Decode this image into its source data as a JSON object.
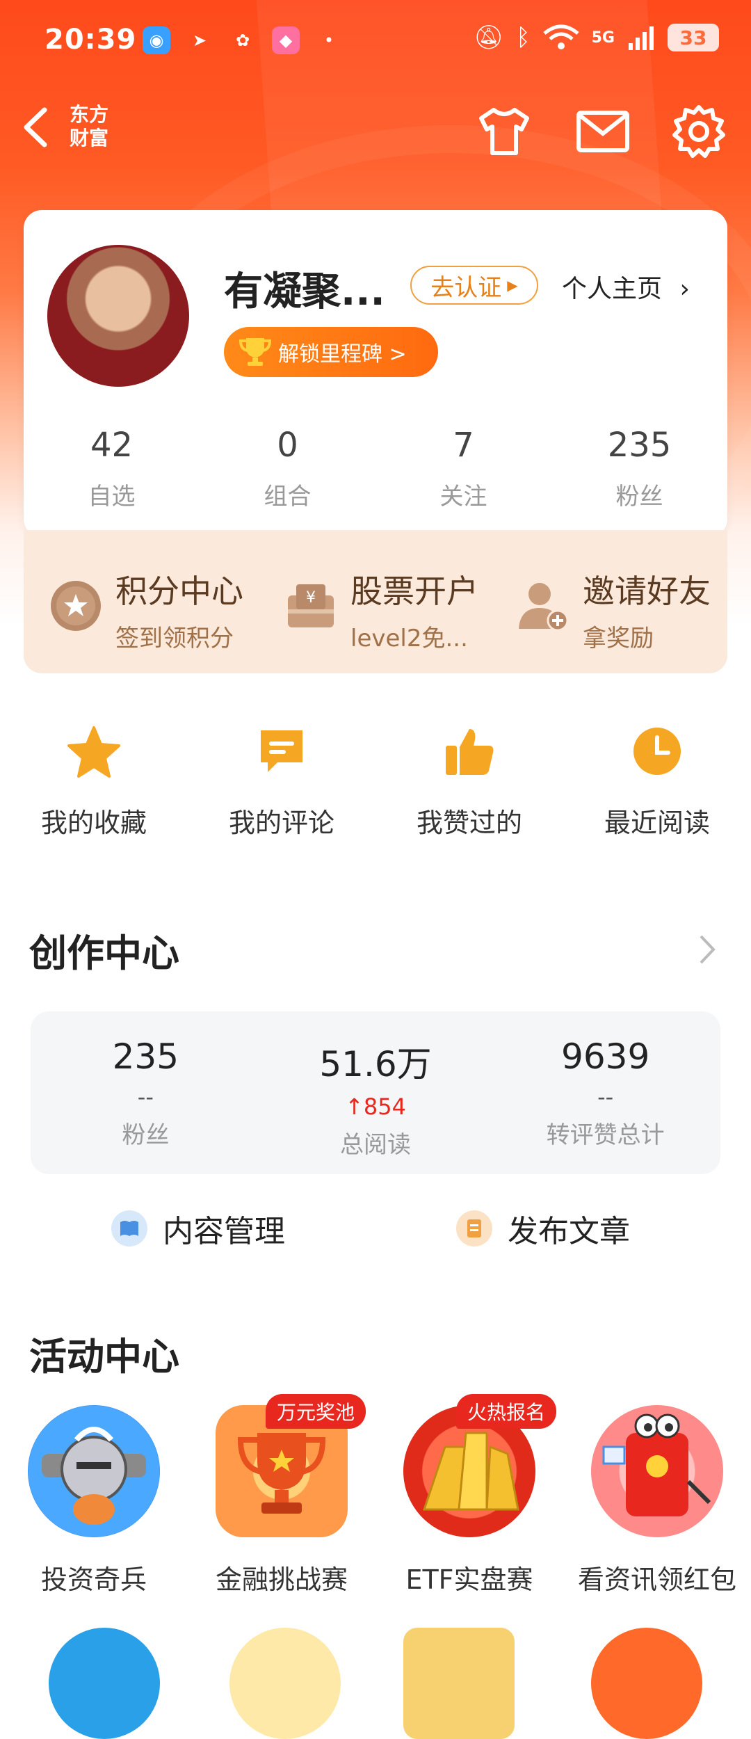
{
  "status": {
    "time": "20:39",
    "network": "5G",
    "battery": "33"
  },
  "nav": {
    "brand_line1": "东方",
    "brand_line2": "财富"
  },
  "profile": {
    "name": "有凝聚...",
    "verify_label": "去认证",
    "homepage_label": "个人主页",
    "milestone_label": "解锁里程碑 >",
    "stats": [
      {
        "value": "42",
        "label": "自选"
      },
      {
        "value": "0",
        "label": "组合"
      },
      {
        "value": "7",
        "label": "关注"
      },
      {
        "value": "235",
        "label": "粉丝"
      }
    ]
  },
  "benefits": [
    {
      "title": "积分中心",
      "sub": "签到领积分"
    },
    {
      "title": "股票开户",
      "sub": "level2免..."
    },
    {
      "title": "邀请好友",
      "sub": "拿奖励"
    }
  ],
  "quick": [
    {
      "label": "我的收藏",
      "icon": "star-icon"
    },
    {
      "label": "我的评论",
      "icon": "comment-icon"
    },
    {
      "label": "我赞过的",
      "icon": "thumbs-up-icon"
    },
    {
      "label": "最近阅读",
      "icon": "clock-icon"
    }
  ],
  "creator": {
    "title": "创作中心",
    "stats": [
      {
        "value": "235",
        "delta": "--",
        "label": "粉丝"
      },
      {
        "value": "51.6万",
        "delta": "854",
        "label": "总阅读"
      },
      {
        "value": "9639",
        "delta": "--",
        "label": "转评赞总计"
      }
    ],
    "actions": [
      {
        "label": "内容管理"
      },
      {
        "label": "发布文章"
      }
    ]
  },
  "activity": {
    "title": "活动中心",
    "items": [
      {
        "label": "投资奇兵",
        "tag": ""
      },
      {
        "label": "金融挑战赛",
        "tag": "万元奖池"
      },
      {
        "label": "ETF实盘赛",
        "tag": "火热报名"
      },
      {
        "label": "看资讯领红包",
        "tag": ""
      }
    ]
  },
  "colors": {
    "brand": "#ff4a1c",
    "accent": "#ff8a18",
    "up": "#e8281e"
  }
}
